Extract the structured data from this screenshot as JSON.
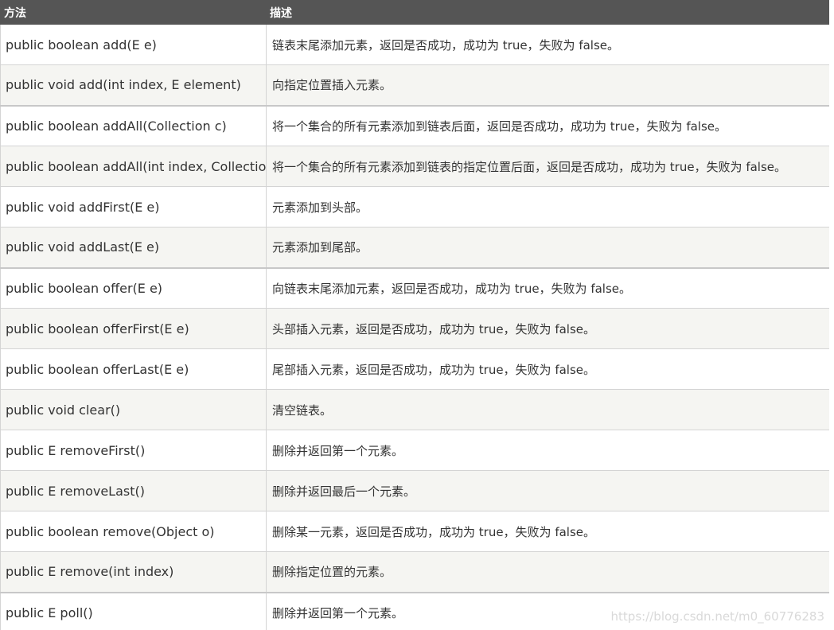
{
  "header": {
    "method": "方法",
    "description": "描述"
  },
  "rows": [
    {
      "method": "public boolean add(E e)",
      "description": "链表末尾添加元素，返回是否成功，成功为 true，失败为 false。"
    },
    {
      "method": "public void add(int index, E element)",
      "description": "向指定位置插入元素。"
    },
    {
      "method": "public boolean addAll(Collection c)",
      "description": "将一个集合的所有元素添加到链表后面，返回是否成功，成功为 true，失败为 false。"
    },
    {
      "method": "public boolean addAll(int index, Collection c)",
      "description": "将一个集合的所有元素添加到链表的指定位置后面，返回是否成功，成功为 true，失败为 false。"
    },
    {
      "method": "public void addFirst(E e)",
      "description": "元素添加到头部。"
    },
    {
      "method": "public void addLast(E e)",
      "description": "元素添加到尾部。"
    },
    {
      "method": "public boolean offer(E e)",
      "description": "向链表末尾添加元素，返回是否成功，成功为 true，失败为 false。"
    },
    {
      "method": "public boolean offerFirst(E e)",
      "description": "头部插入元素，返回是否成功，成功为 true，失败为 false。"
    },
    {
      "method": "public boolean offerLast(E e)",
      "description": "尾部插入元素，返回是否成功，成功为 true，失败为 false。"
    },
    {
      "method": "public void clear()",
      "description": "清空链表。"
    },
    {
      "method": "public E removeFirst()",
      "description": "删除并返回第一个元素。"
    },
    {
      "method": "public E removeLast()",
      "description": "删除并返回最后一个元素。"
    },
    {
      "method": "public boolean remove(Object o)",
      "description": "删除某一元素，返回是否成功，成功为 true，失败为 false。"
    },
    {
      "method": "public E remove(int index)",
      "description": "删除指定位置的元素。"
    },
    {
      "method": "public E poll()",
      "description": "删除并返回第一个元素。"
    }
  ],
  "watermark": "https://blog.csdn.net/m0_60776283"
}
